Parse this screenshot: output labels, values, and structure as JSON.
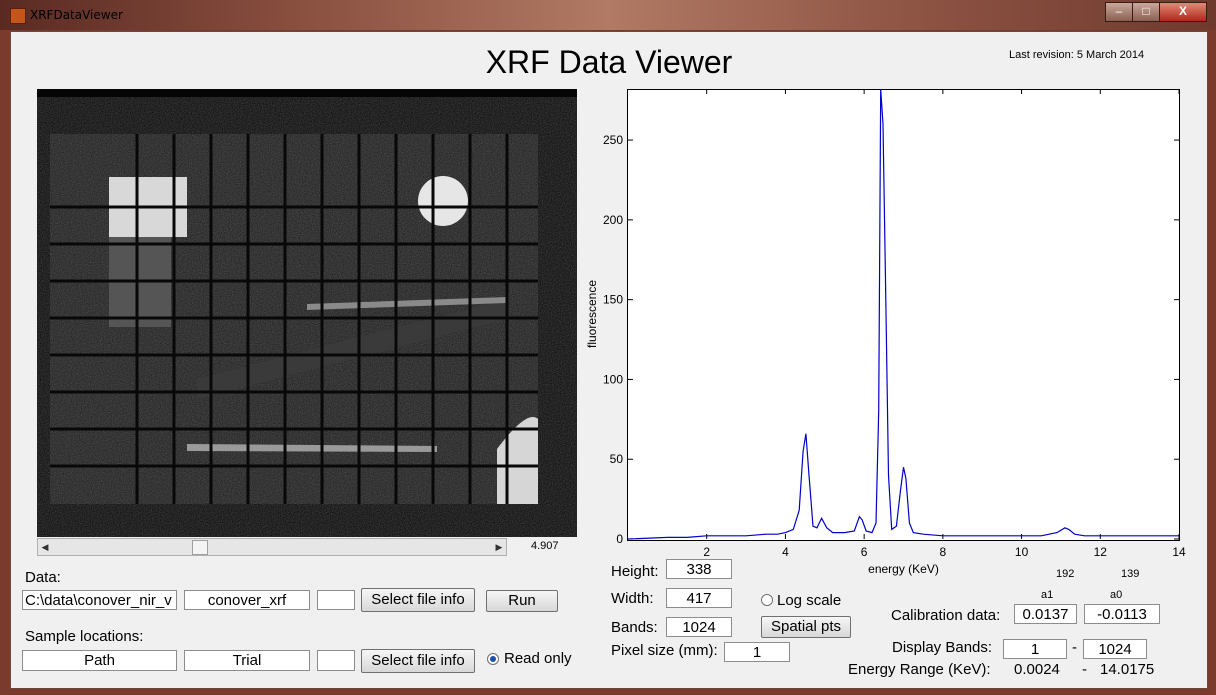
{
  "window": {
    "title": "XRFDataViewer",
    "minimize_glyph": "–",
    "maximize_glyph": "□",
    "close_glyph": "X"
  },
  "header": {
    "title": "XRF Data Viewer",
    "revision": "Last revision: 5 March 2014"
  },
  "image_panel": {
    "scroll_value": "4.907",
    "scroll_position": 0.33
  },
  "data_section": {
    "label": "Data:",
    "path_value": "C:\\data\\conover_nir_v",
    "name_value": "conover_xrf",
    "extra_value": "",
    "select_button": "Select file info",
    "run_button": "Run"
  },
  "sample_section": {
    "label": "Sample locations:",
    "path_value": "Path",
    "name_value": "Trial",
    "extra_value": "",
    "select_button": "Select file info",
    "read_only_label": "Read only",
    "read_only_checked": true
  },
  "dimensions": {
    "height_label": "Height:",
    "height_value": "338",
    "width_label": "Width:",
    "width_value": "417",
    "bands_label": "Bands:",
    "bands_value": "1024",
    "pixel_size_label": "Pixel size (mm):",
    "pixel_size_value": "1"
  },
  "options": {
    "log_scale_label": "Log scale",
    "log_scale_checked": false,
    "spatial_pts_button": "Spatial pts"
  },
  "calibration": {
    "a1_small": "192",
    "a0_small": "139",
    "a1_header": "a1",
    "a0_header": "a0",
    "label": "Calibration data:",
    "a1_value": "0.0137",
    "a0_value": "-0.0113",
    "display_bands_label": "Display Bands:",
    "band_start": "1",
    "band_dash": "-",
    "band_end": "1024",
    "energy_range_label": "Energy Range (KeV):",
    "energy_min": "0.0024",
    "energy_dash": "-",
    "energy_max": "14.0175"
  },
  "colors": {
    "line": "#0000cc",
    "image_bg": "#050505"
  },
  "chart_data": {
    "type": "line",
    "title": "",
    "xlabel": "energy (KeV)",
    "ylabel": "fluorescence",
    "xlim": [
      0,
      14
    ],
    "ylim": [
      0,
      282
    ],
    "x_ticks": [
      2,
      4,
      6,
      8,
      10,
      12,
      14
    ],
    "y_ticks": [
      0,
      50,
      100,
      150,
      200,
      250
    ],
    "grid": false,
    "series": [
      {
        "x": [
          0,
          1.0,
          1.5,
          2.0,
          2.5,
          3.0,
          3.5,
          3.8,
          4.0,
          4.2,
          4.35,
          4.45,
          4.52,
          4.6,
          4.7,
          4.8,
          4.92,
          5.05,
          5.2,
          5.5,
          5.75,
          5.88,
          5.95,
          6.05,
          6.2,
          6.3,
          6.37,
          6.42,
          6.48,
          6.55,
          6.62,
          6.7,
          6.82,
          6.92,
          7.0,
          7.06,
          7.15,
          7.25,
          7.5,
          8.0,
          9.0,
          10.0,
          10.5,
          10.9,
          11.1,
          11.2,
          11.35,
          11.6,
          12.0,
          13.0,
          14.0
        ],
        "y": [
          0,
          1,
          1,
          2,
          2,
          2,
          3,
          3,
          4,
          6,
          18,
          55,
          66,
          40,
          8,
          7,
          13,
          7,
          4,
          4,
          5,
          14,
          12,
          5,
          4,
          10,
          80,
          282,
          260,
          150,
          40,
          6,
          8,
          30,
          45,
          38,
          10,
          4,
          3,
          2,
          2,
          2,
          2,
          4,
          7,
          6,
          3,
          2,
          2,
          2,
          2
        ]
      }
    ]
  }
}
